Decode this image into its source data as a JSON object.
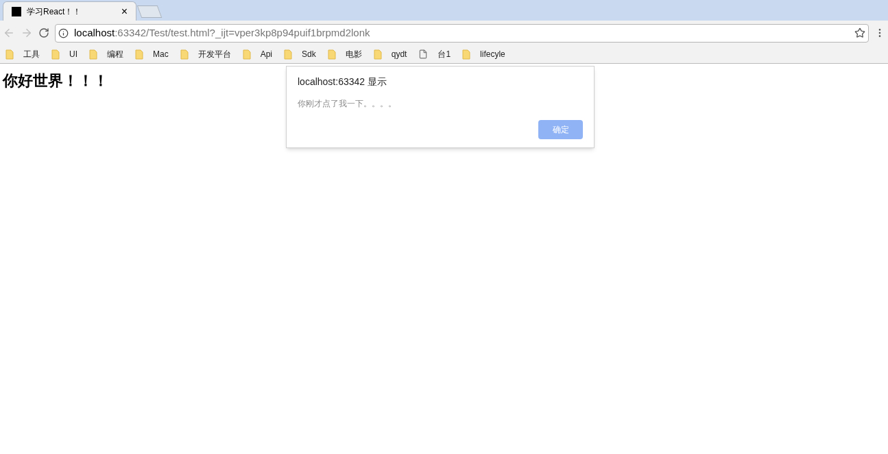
{
  "tabs": [
    {
      "title": "学习React！！",
      "selected": true,
      "close": "×"
    }
  ],
  "address_bar": {
    "host": "localhost",
    "rest": ":63342/Test/test.html?_ijt=vper3kp8p94puif1brpmd2lonk"
  },
  "bookmarks": [
    {
      "label": "工具",
      "kind": "folder"
    },
    {
      "label": "UI",
      "kind": "folder"
    },
    {
      "label": "编程",
      "kind": "folder"
    },
    {
      "label": "Mac",
      "kind": "folder"
    },
    {
      "label": "开发平台",
      "kind": "folder"
    },
    {
      "label": "Api",
      "kind": "folder"
    },
    {
      "label": "Sdk",
      "kind": "folder"
    },
    {
      "label": "电影",
      "kind": "folder"
    },
    {
      "label": "qydt",
      "kind": "folder"
    },
    {
      "label": "台1",
      "kind": "page"
    },
    {
      "label": "lifecyle",
      "kind": "folder"
    }
  ],
  "page": {
    "heading": "你好世界！！！"
  },
  "dialog": {
    "title": "localhost:63342 显示",
    "message": "你刚才点了我一下。。。。",
    "button": "确定"
  }
}
